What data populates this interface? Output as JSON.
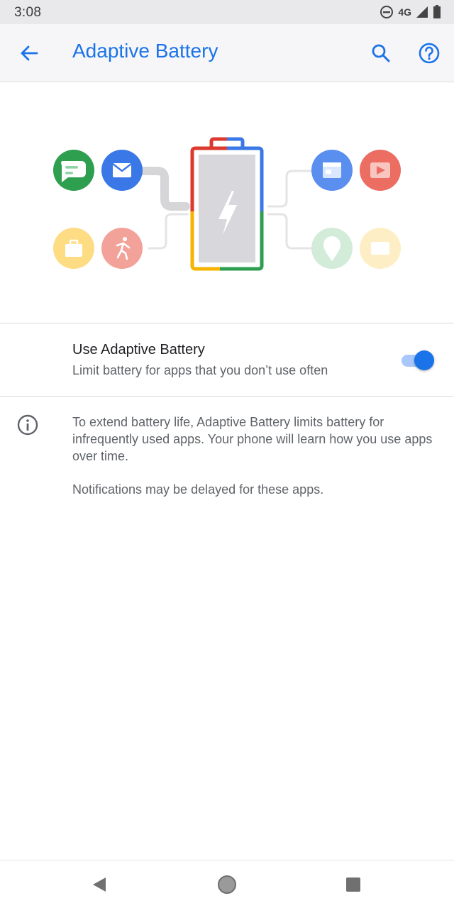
{
  "status_bar": {
    "time": "3:08",
    "network": "4G",
    "icons": [
      "do-not-disturb-icon",
      "signal-icon",
      "battery-icon"
    ]
  },
  "app_bar": {
    "title": "Adaptive Battery",
    "actions": [
      "back-arrow-icon",
      "search-icon",
      "help-icon"
    ]
  },
  "illustration": {
    "apps_left": [
      "messages-icon",
      "email-icon",
      "briefcase-icon",
      "fitness-icon"
    ],
    "apps_right": [
      "calendar-icon",
      "video-icon",
      "location-icon",
      "message-card-icon"
    ],
    "center": "battery-bolt-icon"
  },
  "setting": {
    "title": "Use Adaptive Battery",
    "summary": "Limit battery for apps that you don’t use often",
    "enabled": true
  },
  "footer": {
    "paragraph1": "To extend battery life, Adaptive Battery limits battery for infrequently used apps. Your phone will learn how you use apps over time.",
    "paragraph2": "Notifications may be delayed for these apps."
  },
  "nav_bar": {
    "buttons": [
      "nav-back-icon",
      "nav-home-icon",
      "nav-recents-icon"
    ]
  },
  "colors": {
    "accent": "#1a73e8",
    "green": "#1e8e3e",
    "red": "#d93025",
    "yellow": "#f9ab00"
  }
}
